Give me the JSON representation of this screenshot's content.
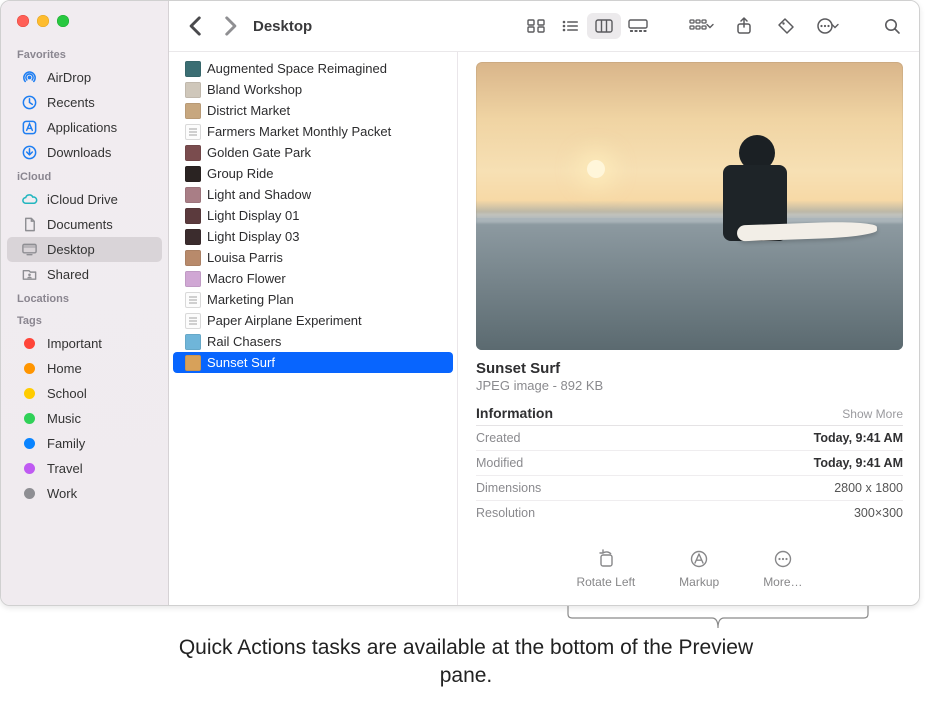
{
  "window": {
    "title": "Desktop"
  },
  "traffic": {
    "close": "close",
    "minimize": "minimize",
    "zoom": "zoom"
  },
  "sidebar": {
    "sections": [
      {
        "label": "Favorites",
        "items": [
          {
            "icon": "airdrop",
            "label": "AirDrop"
          },
          {
            "icon": "clock",
            "label": "Recents"
          },
          {
            "icon": "applications",
            "label": "Applications"
          },
          {
            "icon": "downloads",
            "label": "Downloads"
          }
        ]
      },
      {
        "label": "iCloud",
        "items": [
          {
            "icon": "icloud",
            "label": "iCloud Drive"
          },
          {
            "icon": "document",
            "label": "Documents"
          },
          {
            "icon": "desktop",
            "label": "Desktop",
            "selected": true
          },
          {
            "icon": "shared",
            "label": "Shared"
          }
        ]
      },
      {
        "label": "Locations",
        "items": []
      },
      {
        "label": "Tags",
        "items": [
          {
            "icon": "tag",
            "color": "#ff4539",
            "label": "Important"
          },
          {
            "icon": "tag",
            "color": "#ff9500",
            "label": "Home"
          },
          {
            "icon": "tag",
            "color": "#ffcc00",
            "label": "School"
          },
          {
            "icon": "tag",
            "color": "#30d158",
            "label": "Music"
          },
          {
            "icon": "tag",
            "color": "#0a84ff",
            "label": "Family"
          },
          {
            "icon": "tag",
            "color": "#bf5af2",
            "label": "Travel"
          },
          {
            "icon": "tag",
            "color": "#8e8e93",
            "label": "Work"
          }
        ]
      }
    ]
  },
  "toolbar": {
    "back": "Back",
    "forward": "Forward",
    "view_icon": "Icon View",
    "view_list": "List View",
    "view_column": "Column View",
    "view_gallery": "Gallery View",
    "group": "Group",
    "share": "Share",
    "tags": "Edit Tags",
    "action": "Action",
    "search": "Search"
  },
  "files": [
    {
      "name": "Augmented Space Reimagined",
      "thumb": "img",
      "bg": "#3b6e73"
    },
    {
      "name": "Bland Workshop",
      "thumb": "img",
      "bg": "#cfc7ba"
    },
    {
      "name": "District Market",
      "thumb": "img",
      "bg": "#c7a77f"
    },
    {
      "name": "Farmers Market Monthly Packet",
      "thumb": "doc"
    },
    {
      "name": "Golden Gate Park",
      "thumb": "img",
      "bg": "#7a4c4e"
    },
    {
      "name": "Group Ride",
      "thumb": "img",
      "bg": "#2a2322"
    },
    {
      "name": "Light and Shadow",
      "thumb": "img",
      "bg": "#a97e86"
    },
    {
      "name": "Light Display 01",
      "thumb": "img",
      "bg": "#5b3a3d"
    },
    {
      "name": "Light Display 03",
      "thumb": "img",
      "bg": "#3b2c2d"
    },
    {
      "name": "Louisa Parris",
      "thumb": "img",
      "bg": "#b88a6b"
    },
    {
      "name": "Macro Flower",
      "thumb": "img",
      "bg": "#d0a7d4"
    },
    {
      "name": "Marketing Plan",
      "thumb": "doc"
    },
    {
      "name": "Paper Airplane Experiment",
      "thumb": "doc"
    },
    {
      "name": "Rail Chasers",
      "thumb": "img",
      "bg": "#6fb5d9"
    },
    {
      "name": "Sunset Surf",
      "thumb": "img",
      "bg": "#d7a15a",
      "selected": true
    }
  ],
  "preview": {
    "title": "Sunset Surf",
    "subtitle": "JPEG image - 892 KB",
    "info_label": "Information",
    "show_more": "Show More",
    "rows": [
      {
        "k": "Created",
        "v": "Today, 9:41 AM",
        "strong": true
      },
      {
        "k": "Modified",
        "v": "Today, 9:41 AM",
        "strong": true
      },
      {
        "k": "Dimensions",
        "v": "2800 x 1800"
      },
      {
        "k": "Resolution",
        "v": "300×300"
      }
    ],
    "actions": {
      "rotate": "Rotate Left",
      "markup": "Markup",
      "more": "More…"
    }
  },
  "callout": "Quick Actions tasks are available at the bottom of the Preview pane."
}
